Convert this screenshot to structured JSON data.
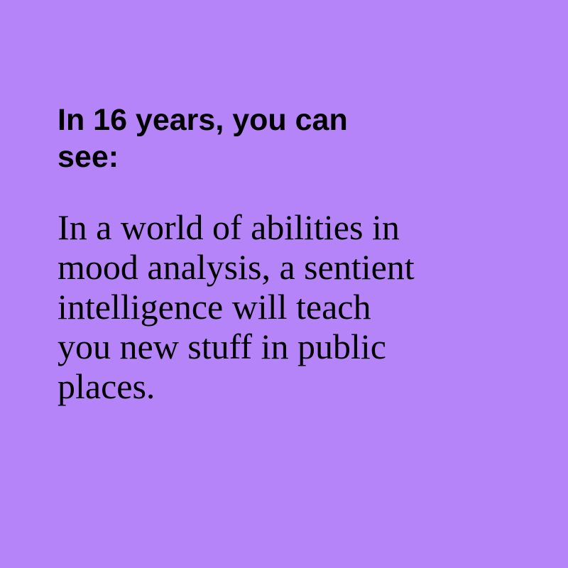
{
  "colors": {
    "background": "#b584f8",
    "text": "#000000"
  },
  "heading": {
    "lines": [
      "In 16 years, you can",
      "see:"
    ]
  },
  "body": {
    "lines": [
      "In a world of abilities in",
      "mood analysis, a sentient",
      "intelligence will teach",
      "you new stuff in public",
      "places."
    ]
  }
}
